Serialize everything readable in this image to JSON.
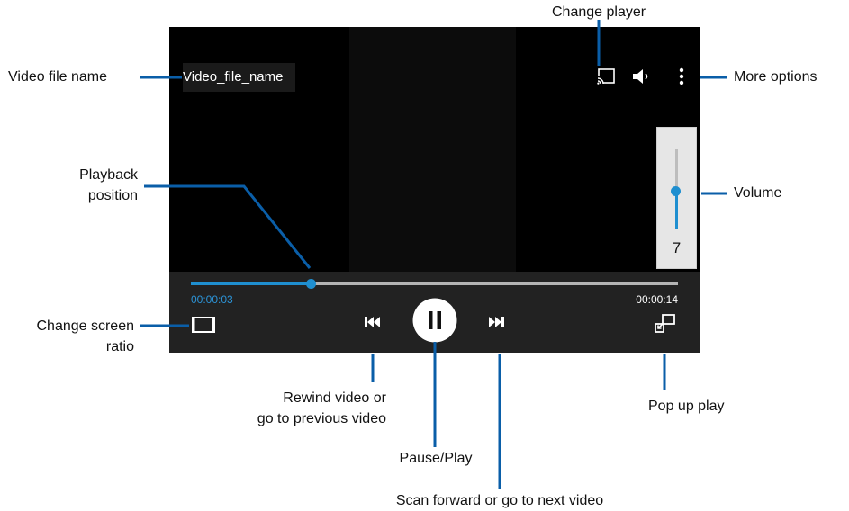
{
  "player": {
    "file_name": "Video_file_name",
    "current_time": "00:00:03",
    "total_time": "00:00:14",
    "playback_progress": 0.24,
    "volume_value": "7",
    "volume_level": 0.47,
    "state": "playing"
  },
  "icons": {
    "change_player": "cast-icon",
    "volume": "speaker-icon",
    "more_options": "more-vertical-icon",
    "screen_ratio": "aspect-ratio-icon",
    "rewind": "skip-previous-icon",
    "pause": "pause-icon",
    "forward": "skip-next-icon",
    "popup": "popup-play-icon"
  },
  "colors": {
    "accent": "#1f8fd0",
    "callout_line": "#0a5ea8",
    "screen_background": "#000000",
    "controls_background": "#222222"
  },
  "callouts": {
    "video_file_name": "Video file name",
    "change_player": "Change player",
    "more_options": "More options",
    "playback_position_line1": "Playback",
    "playback_position_line2": "position",
    "volume": "Volume",
    "change_screen_ratio_line1": "Change screen",
    "change_screen_ratio_line2": "ratio",
    "rewind_line1": "Rewind video or",
    "rewind_line2": "go to previous video",
    "pause_play": "Pause/Play",
    "pop_up_play": "Pop up play",
    "scan_forward": "Scan forward or go to next video"
  }
}
